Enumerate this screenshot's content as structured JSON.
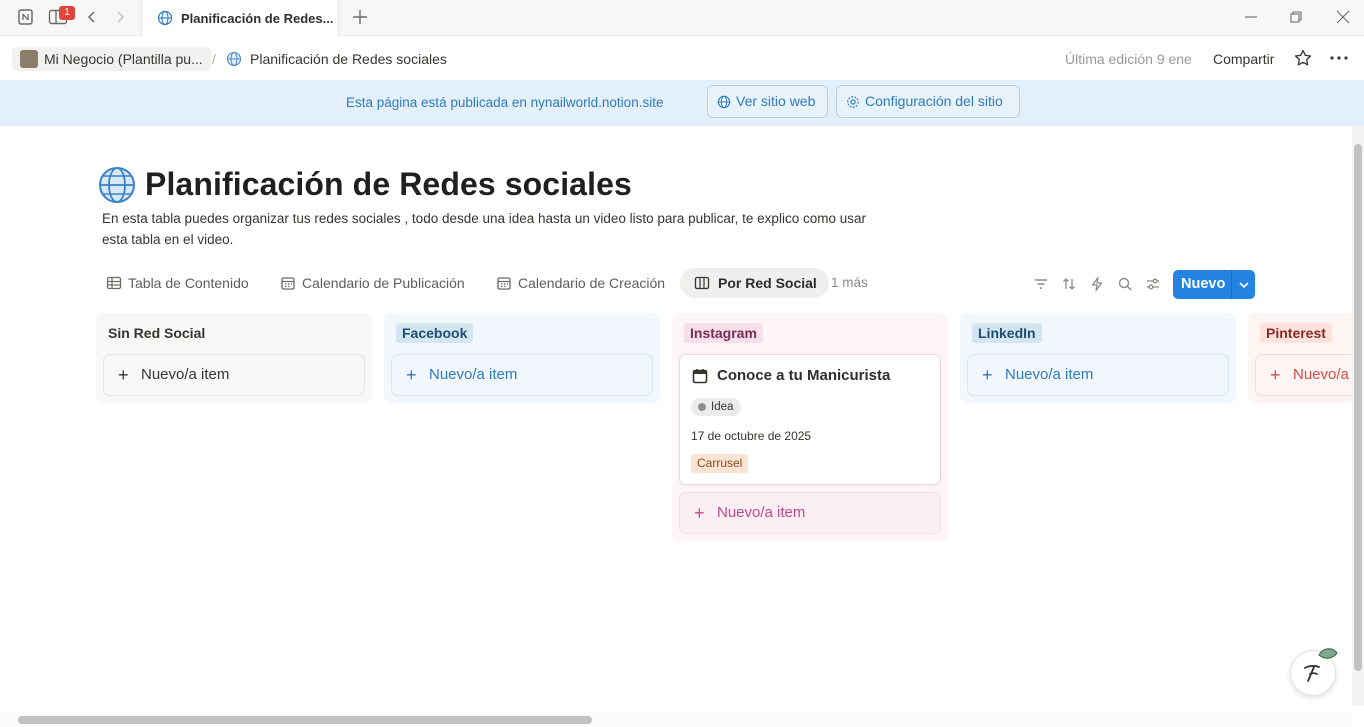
{
  "browser": {
    "tab_title": "Planificación de Redes...",
    "notification_count": "1"
  },
  "header": {
    "workspace": "Mi Negocio (Plantilla pu...",
    "separator": "/",
    "page": "Planificación de Redes sociales",
    "last_edit": "Última edición 9 ene",
    "share": "Compartir"
  },
  "banner": {
    "text": "Esta página está publicada en nynailworld.notion.site",
    "view_site": "Ver sitio web",
    "site_config": "Configuración del sitio"
  },
  "page": {
    "title": "Planificación de Redes sociales",
    "description": "En esta tabla puedes organizar tus redes sociales , todo desde una idea hasta un video listo para publicar, te explico como usar esta tabla en el video."
  },
  "views": {
    "tabs": [
      {
        "label": "Tabla de Contenido",
        "icon": "table-icon"
      },
      {
        "label": "Calendario de Publicación",
        "icon": "calendar-icon"
      },
      {
        "label": "Calendario de Creación",
        "icon": "calendar-icon"
      },
      {
        "label": "Por Red Social",
        "icon": "board-icon",
        "active": true
      }
    ],
    "more": "1 más",
    "new_button": "Nuevo"
  },
  "board": {
    "columns": [
      {
        "name": "Sin Red Social",
        "add_label": "Nuevo/a item",
        "color": "#f7f7f5",
        "tag_color": "transparent",
        "accent": "#37352f"
      },
      {
        "name": "Facebook",
        "add_label": "Nuevo/a item",
        "color": "#f1f7fc",
        "tag_color": "#d3e5ef",
        "accent": "#2f7bbf"
      },
      {
        "name": "Instagram",
        "add_label": "Nuevo/a item",
        "color": "#fdf5f7",
        "tag_color": "#f5e0e9",
        "accent": "#c14c8a"
      },
      {
        "name": "LinkedIn",
        "add_label": "Nuevo/a item",
        "color": "#f1f7fc",
        "tag_color": "#d3e5ef",
        "accent": "#2f7bbf"
      },
      {
        "name": "Pinterest",
        "add_label": "Nuevo/a item",
        "color": "#fdf5f4",
        "tag_color": "#ffe2dd",
        "accent": "#d44c47"
      }
    ],
    "card": {
      "title": "Conoce a tu Manicurista",
      "status": "Idea",
      "date": "17 de octubre de 2025",
      "tag": "Carrusel"
    }
  }
}
